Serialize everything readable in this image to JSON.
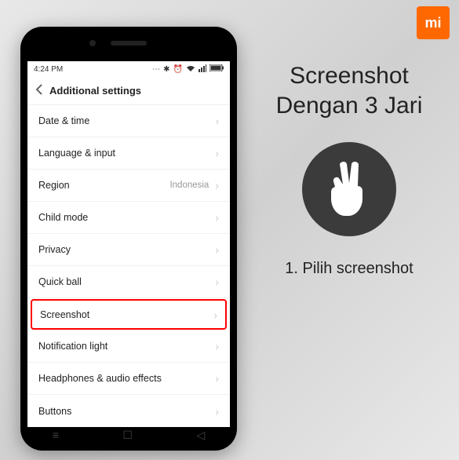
{
  "brand": {
    "logo": "mi"
  },
  "status": {
    "time": "4:24 PM"
  },
  "header": {
    "title": "Additional settings"
  },
  "settings": {
    "items": [
      {
        "label": "Date & time",
        "value": ""
      },
      {
        "label": "Language & input",
        "value": ""
      },
      {
        "label": "Region",
        "value": "Indonesia"
      },
      {
        "label": "Child mode",
        "value": ""
      },
      {
        "label": "Privacy",
        "value": ""
      },
      {
        "label": "Quick ball",
        "value": ""
      },
      {
        "label": "Screenshot",
        "value": ""
      },
      {
        "label": "Notification light",
        "value": ""
      },
      {
        "label": "Headphones & audio effects",
        "value": ""
      },
      {
        "label": "Buttons",
        "value": ""
      }
    ],
    "highlighted_index": 6
  },
  "instruction": {
    "title_line1": "Screenshot",
    "title_line2": "Dengan 3 Jari",
    "step": "1. Pilih screenshot"
  }
}
